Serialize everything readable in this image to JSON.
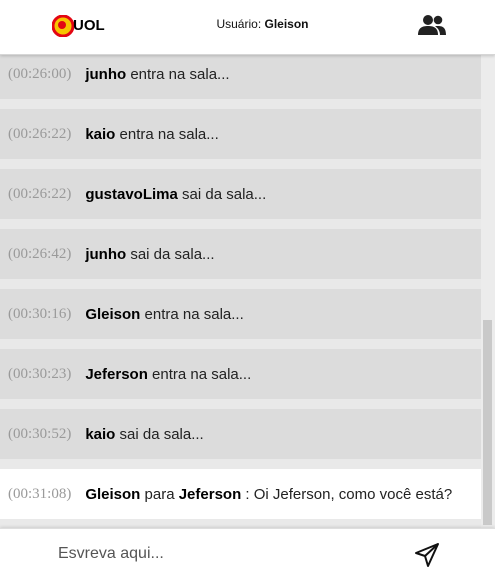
{
  "header": {
    "logo_text": "UOL",
    "user_label": "Usuário:",
    "user_name": "Gleison",
    "people_icon": "people-icon"
  },
  "messages": [
    {
      "time": "(00:26:00)",
      "name": "junho",
      "text": "entra na sala...",
      "type": "status"
    },
    {
      "time": "(00:26:22)",
      "name": "kaio",
      "text": "entra na sala...",
      "type": "status"
    },
    {
      "time": "(00:26:22)",
      "name": "gustavoLima",
      "text": "sai da sala...",
      "type": "status"
    },
    {
      "time": "(00:26:42)",
      "name": "junho",
      "text": "sai da sala...",
      "type": "status"
    },
    {
      "time": "(00:30:16)",
      "name": "Gleison",
      "text": "entra na sala...",
      "type": "status"
    },
    {
      "time": "(00:30:23)",
      "name": "Jeferson",
      "text": "entra na sala...",
      "type": "status"
    },
    {
      "time": "(00:30:52)",
      "name": "kaio",
      "text": "sai da sala...",
      "type": "status"
    },
    {
      "time": "(00:31:08)",
      "name": "Gleison",
      "to_word": "para",
      "recipient": "Jeferson",
      "text": ": Oi Jeferson, como você está?",
      "type": "message"
    }
  ],
  "footer": {
    "placeholder": "Esvreva aqui...",
    "send_icon": "send-icon"
  },
  "colors": {
    "status_bg": "#dcdcdc",
    "message_bg": "#ffffff",
    "time": "#9a9a9a",
    "logo_red": "#e30613",
    "logo_yellow": "#f7c400"
  }
}
